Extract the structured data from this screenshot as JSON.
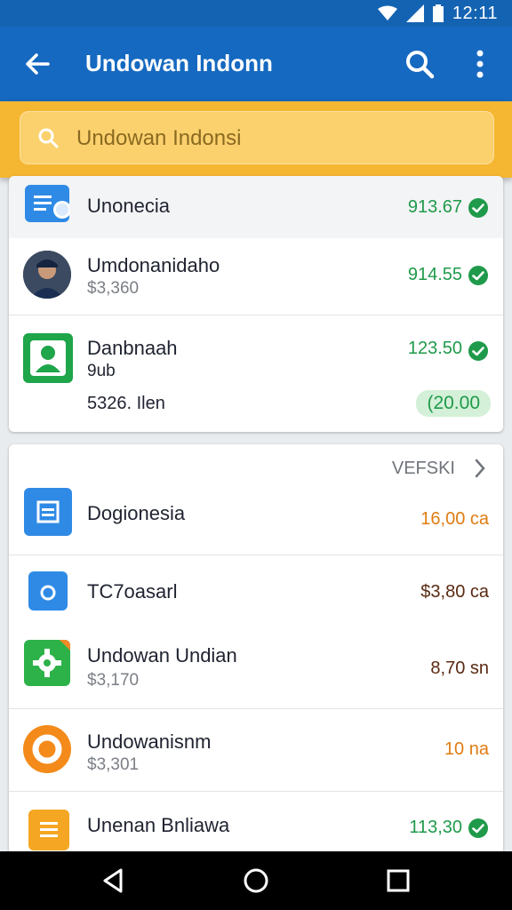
{
  "status_bar": {
    "time": "12:11"
  },
  "app_bar": {
    "title": "Undowan Indonn"
  },
  "search": {
    "value": "Undowan Indonsi"
  },
  "card1": {
    "rows": [
      {
        "name": "Unonecia",
        "amount": "913.67"
      },
      {
        "name": "Umdonanidaho",
        "sub": "$3,360",
        "amount": "914.55"
      },
      {
        "name": "Danbnaah",
        "sub": "9ub",
        "sub2": "5326. Ilen",
        "amount": "123.50",
        "pill": "(20.00"
      }
    ]
  },
  "card2": {
    "header": "VEFSKI",
    "rows": [
      {
        "name": "Dogionesia",
        "amount": "16,00 ca"
      },
      {
        "name": "TC7oasarl",
        "amount": "$3,80 ca"
      },
      {
        "name": "Undowan Undian",
        "sub": "$3,170",
        "amount": "8,70 sn"
      },
      {
        "name": "Undowanisnm",
        "sub": "$3,301",
        "amount": "10 na"
      },
      {
        "name": "Unenan Bnliawa",
        "amount": "113,30"
      }
    ]
  },
  "colors": {
    "primary": "#1569c0",
    "accent": "#f5b731",
    "positive": "#1f9a4a",
    "warning": "#e07c12"
  }
}
